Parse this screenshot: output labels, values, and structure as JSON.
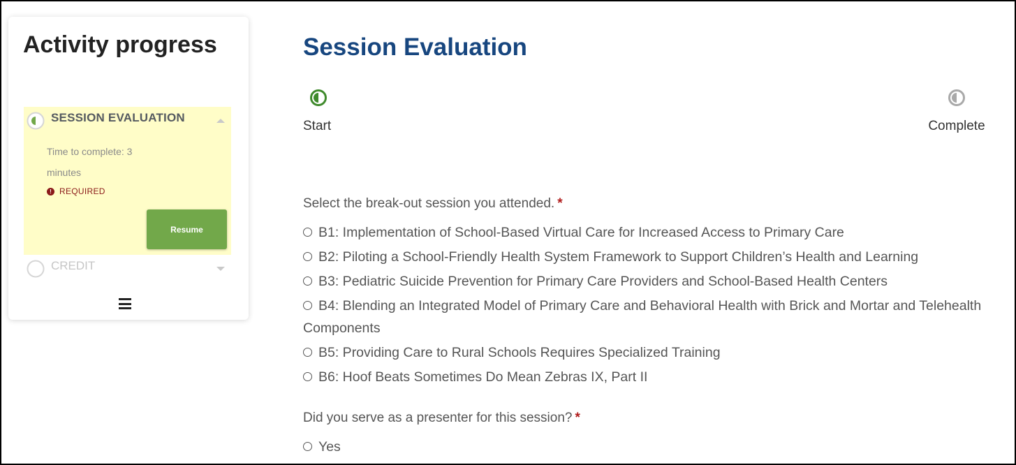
{
  "sidebar": {
    "title": "Activity progress",
    "steps": [
      {
        "title": "SESSION EVALUATION",
        "time_to_complete": "Time to complete: 3 minutes",
        "required_label": "REQUIRED",
        "resume_label": "Resume",
        "status": "in-progress"
      },
      {
        "title": "CREDIT",
        "status": "not-started"
      }
    ]
  },
  "main": {
    "title": "Session Evaluation",
    "progress": {
      "start_label": "Start",
      "complete_label": "Complete"
    },
    "questions": [
      {
        "text": "Select the break-out session you attended.",
        "required_marker": "*",
        "options": [
          "B1: Implementation of School-Based Virtual Care for Increased Access to Primary Care",
          "B2: Piloting a School-Friendly Health System Framework to Support Children’s Health and Learning",
          "B3: Pediatric Suicide Prevention for Primary Care Providers and School-Based Health Centers",
          "B4: Blending an Integrated Model of Primary Care and Behavioral Health with Brick and Mortar and Telehealth Components",
          "B5: Providing Care to Rural Schools Requires Specialized Training",
          "B6: Hoof Beats Sometimes Do Mean Zebras IX, Part II"
        ]
      },
      {
        "text": "Did you serve as a presenter for this session?",
        "required_marker": "*",
        "options": [
          "Yes"
        ]
      }
    ]
  },
  "colors": {
    "title_blue": "#17467f",
    "accent_green": "#72a84a",
    "progress_green": "#3f8a2c",
    "highlight_yellow": "#fffdc8",
    "required_red": "#8b1a1a",
    "inactive_gray": "#a9a9a9"
  },
  "icons": {
    "step_active": "half-circle-icon",
    "step_inactive": "empty-circle-icon",
    "required": "exclamation-circle-icon",
    "menu": "hamburger-menu-icon"
  }
}
